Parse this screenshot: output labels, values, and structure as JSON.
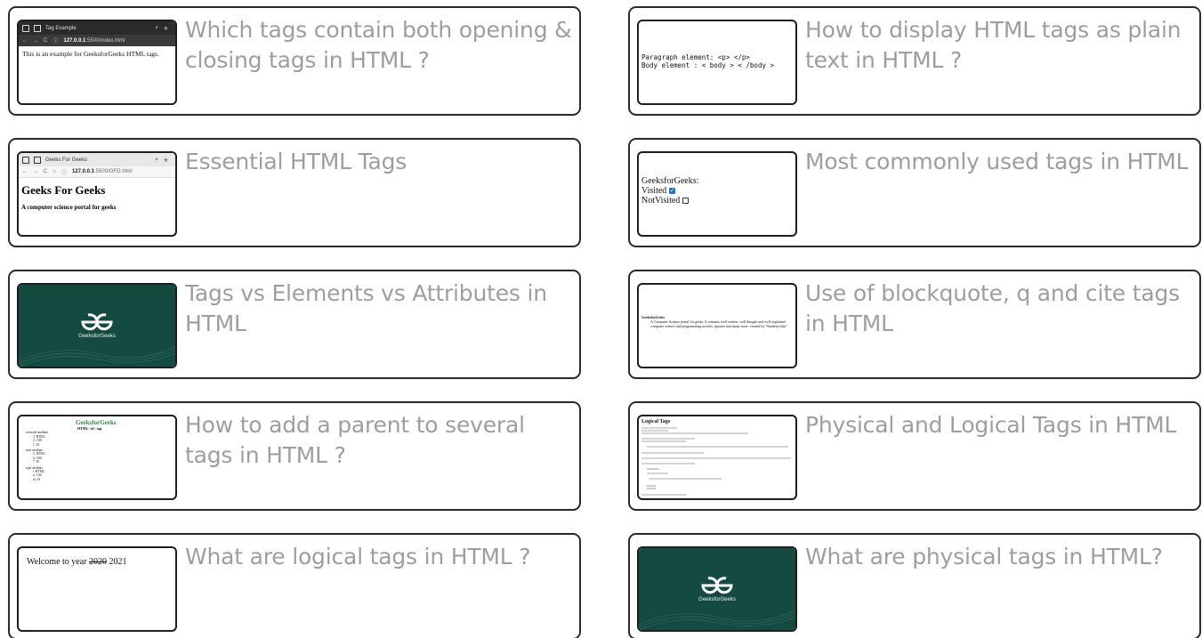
{
  "cards": [
    {
      "title": "Which tags contain both opening & closing tags in HTML ?",
      "thumb": {
        "tab": "Tag Example",
        "url_host": "127.0.0.1",
        "url_rest": ":5500/index.html",
        "text": "This is an example for GeeksforGeeks HTML tags."
      }
    },
    {
      "title": "How to display HTML tags as plain text in HTML ?",
      "thumb": {
        "line1": "Paragraph element: <p> </p>",
        "line2": "Body element : < body > < /body >"
      }
    },
    {
      "title": "Essential HTML Tags",
      "thumb": {
        "tab": "Geeks For Geeks",
        "url_host": "127.0.0.1",
        "url_rest": ":5500/GFG.html",
        "h1": "Geeks For Geeks",
        "h4": "A computer science portal for geeks"
      }
    },
    {
      "title": "Most commonly used tags in HTML",
      "thumb": {
        "heading": "GeeksforGeeks:",
        "opt1": "Visited",
        "opt2": "NotVisited"
      }
    },
    {
      "title": "Tags vs Elements vs Attributes in HTML",
      "thumb": {
        "brand": "GeeksforGeeks"
      }
    },
    {
      "title": "Use of blockquote, q and cite tags in HTML",
      "thumb": {
        "heading": "GeeksforGeeks",
        "quote": "A Computer Science portal for geeks. It contains well written, well thought and well explained computer science and programming articles, quizzes and many more. created by \"Sandeep Jain\""
      }
    },
    {
      "title": "How to add a parent to several tags in HTML ?",
      "thumb": {
        "heading": "GeeksforGeeks",
        "sub": "HTML <ol> tag",
        "groups": [
          {
            "label": "reversed attribute",
            "items": [
              "3. HTML",
              "2. CSS",
              "1. JS"
            ]
          },
          {
            "label": "start attribute",
            "items": [
              "5. HTML",
              "6. CSS",
              "7. JS"
            ]
          },
          {
            "label": "type attribute",
            "items": [
              "i. HTML",
              "ii. CSS",
              "iii. JS"
            ]
          }
        ]
      }
    },
    {
      "title": "Physical and Logical Tags in HTML",
      "thumb": {
        "heading": "Logical Tags"
      }
    },
    {
      "title": "What are logical tags in HTML ?",
      "thumb": {
        "prefix": "Welcome to year ",
        "old_year": "2020",
        "new_year": " 2021"
      }
    },
    {
      "title": "What are physical tags in HTML?",
      "thumb": {
        "brand": "GeeksforGeeks"
      }
    }
  ],
  "colors": {
    "title_text": "#9e9e9e",
    "card_border": "#2a2a2a",
    "banner": "#154a40",
    "gfg_green": "#2f8d46"
  },
  "icons": [
    "tab-page-icon",
    "back-arrow-icon",
    "forward-arrow-icon",
    "reload-icon",
    "info-icon",
    "home-icon",
    "gfg-logo-icon",
    "checkbox-checked-icon",
    "checkbox-empty-icon"
  ]
}
